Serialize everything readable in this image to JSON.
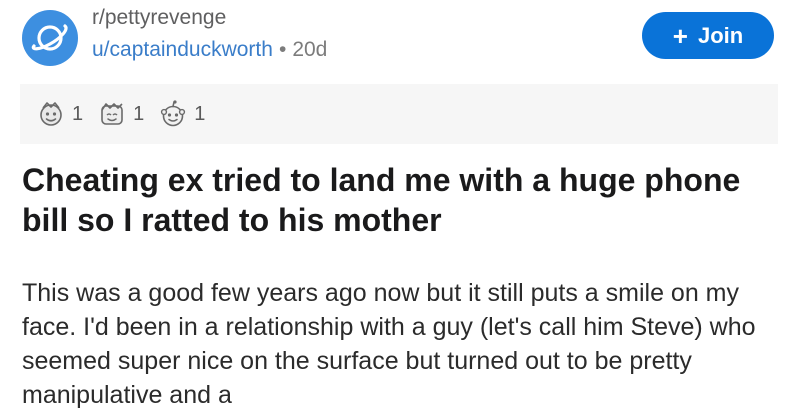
{
  "header": {
    "subreddit": "r/pettyrevenge",
    "username": "u/captainduckworth",
    "separator": "•",
    "age": "20d",
    "join_label": "Join",
    "join_plus": "+",
    "brand_color": "#0a73d8",
    "subreddit_icon": "planet-icon"
  },
  "awards": [
    {
      "icon": "award-helpful-icon",
      "count": "1"
    },
    {
      "icon": "award-wholesome-icon",
      "count": "1"
    },
    {
      "icon": "award-silver-icon",
      "count": "1"
    }
  ],
  "post": {
    "title": "Cheating ex tried to land me with a huge phone bill so I ratted to his mother",
    "body": "This was a good few years ago now but it still puts a smile on my face. I'd been in a relationship with a guy (let's call him Steve) who seemed super nice on the surface but turned out to be pretty manipulative and a"
  }
}
